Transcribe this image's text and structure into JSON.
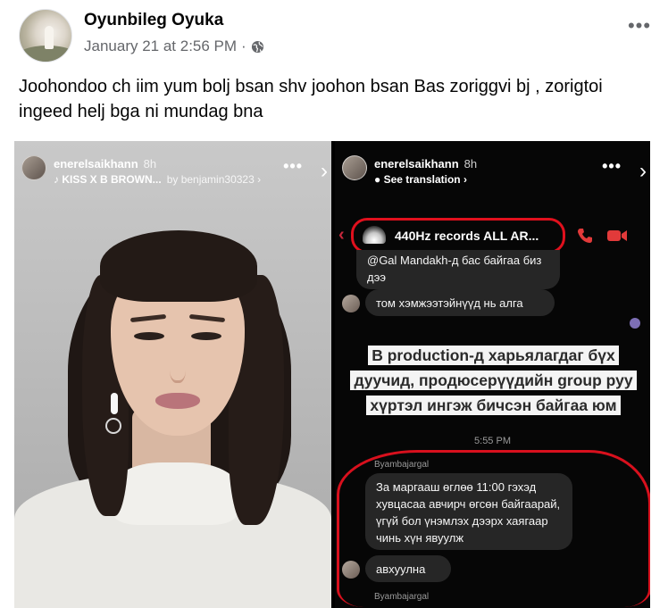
{
  "post": {
    "author": "Oyunbileg Oyuka",
    "timestamp": "January 21 at 2:56 PM",
    "separator": "·",
    "privacy_icon": "globe-icon",
    "more_label": "•••",
    "text": "Joohondoo ch iim yum bolj bsan shv joohon bsan Bas zoriggvi bj , zorigtoi ingeed helj bga ni mundag bna"
  },
  "story_left": {
    "username": "enerelsaikhann",
    "age": "8h",
    "music": "♪ KISS X B BROWN...",
    "music_by": "by benjamin30323 ›",
    "dots": "•••",
    "next": "›"
  },
  "story_right": {
    "username": "enerelsaikhann",
    "age": "8h",
    "translation": "● See translation ›",
    "dots": "•••",
    "next": "›",
    "chat": {
      "group_name": "440Hz records ALL AR...",
      "back_label": "‹",
      "messages": [
        "@Gal Mandakh-д бас байгаа биз дээ",
        "том хэмжээтэйнүүд нь алга"
      ],
      "caption": "В production-д харьялагдаг бүх дуучид, продюсерүүдийн group руу хүртэл ингэж бичсэн байгаа юм",
      "time": "5:55 PM",
      "sender": "Byambajargal",
      "message_long": "За маргааш өглөө 11:00 гэхэд хувцасаа авчирч өгсөн байгаарай, үгүй бол үнэмлэх дээрх хаягаар чинь хүн явуулж",
      "message_short": "авхуулна",
      "sender_bottom": "Byambajargal"
    }
  },
  "colors": {
    "text": "#050505",
    "meta": "#65676b",
    "red_marker": "#e0101d",
    "bubble": "#262626"
  }
}
